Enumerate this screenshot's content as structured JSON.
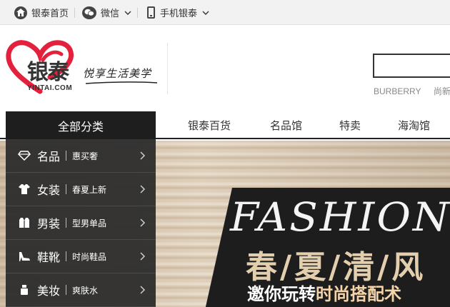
{
  "topbar": {
    "home_label": "银泰首页",
    "wechat_label": "微信",
    "mobile_label": "手机银泰"
  },
  "logo": {
    "brand_cn": "银泰",
    "brand_en": "YINTAI.COM",
    "slogan": "悦享生活美学"
  },
  "search": {
    "hot_words": [
      "BURBERRY",
      "尚新"
    ]
  },
  "nav": {
    "category_title": "全部分类",
    "items": [
      "银泰百货",
      "名品馆",
      "特卖",
      "海淘馆"
    ]
  },
  "categories": [
    {
      "name": "名品",
      "desc": "惠买奢",
      "icon": "diamond-icon"
    },
    {
      "name": "女装",
      "desc": "春夏上新",
      "icon": "dress-icon"
    },
    {
      "name": "男装",
      "desc": "型男单品",
      "icon": "suit-icon"
    },
    {
      "name": "鞋靴",
      "desc": "时尚鞋品",
      "icon": "heel-icon"
    },
    {
      "name": "美妆",
      "desc": "爽肤水",
      "icon": "cosmetics-icon"
    }
  ],
  "banner": {
    "headline_en": "FASHION",
    "headline_cn": "春/夏/清/风",
    "tagline_a": "邀你玩转",
    "tagline_b": "时尚搭配术"
  },
  "colors": {
    "brand_red": "#e4213d",
    "sidebar_bg": "#2e2e2e",
    "banner_accent": "#e3cfae"
  }
}
